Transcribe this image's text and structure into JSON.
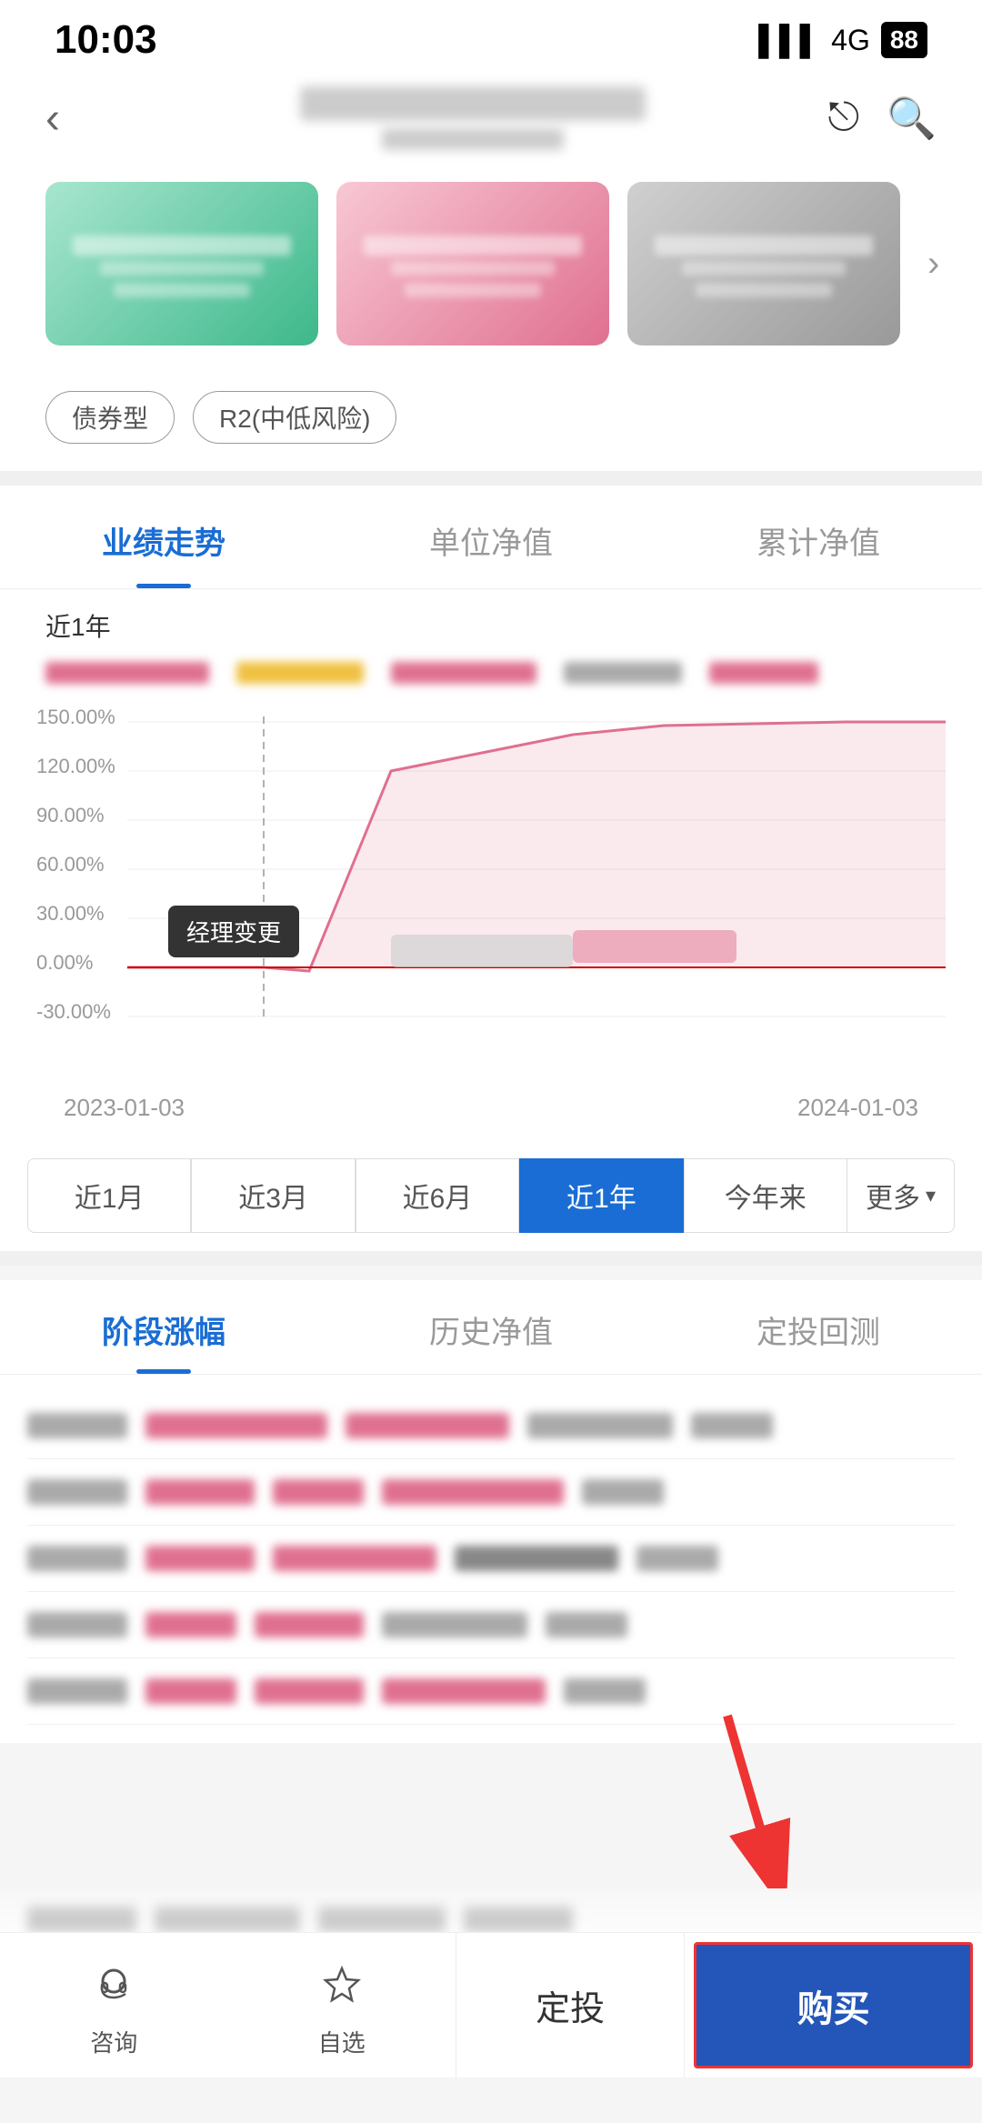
{
  "status": {
    "time": "10:03",
    "signal": "4G",
    "battery": "88"
  },
  "nav": {
    "back_icon": "‹",
    "share_icon": "⬡",
    "search_icon": "🔍"
  },
  "tags": [
    "债券型",
    "R2(中低风险)"
  ],
  "chart_tabs": {
    "items": [
      "业绩走势",
      "单位净值",
      "累计净值"
    ],
    "active": 0
  },
  "chart": {
    "period_label": "近1年",
    "y_labels": [
      "150.00%",
      "120.00%",
      "90.00%",
      "60.00%",
      "30.00%",
      "0.00%",
      "-30.00%"
    ],
    "x_labels": [
      "2023-01-03",
      "2024-01-03"
    ],
    "manager_change_label": "经理变更",
    "time_filters": [
      "近1月",
      "近3月",
      "近6月",
      "近1年",
      "今年来",
      "更多"
    ],
    "active_filter": 3
  },
  "sub_tabs": {
    "items": [
      "阶段涨幅",
      "历史净值",
      "定投回测"
    ],
    "active": 0
  },
  "bottom_nav": {
    "consult_label": "咨询",
    "fav_label": "自选",
    "dingTou_label": "定投",
    "buy_label": "购买"
  },
  "colors": {
    "primary_blue": "#1a6dd4",
    "red": "#e33333",
    "buy_btn_bg": "#2356b8"
  }
}
